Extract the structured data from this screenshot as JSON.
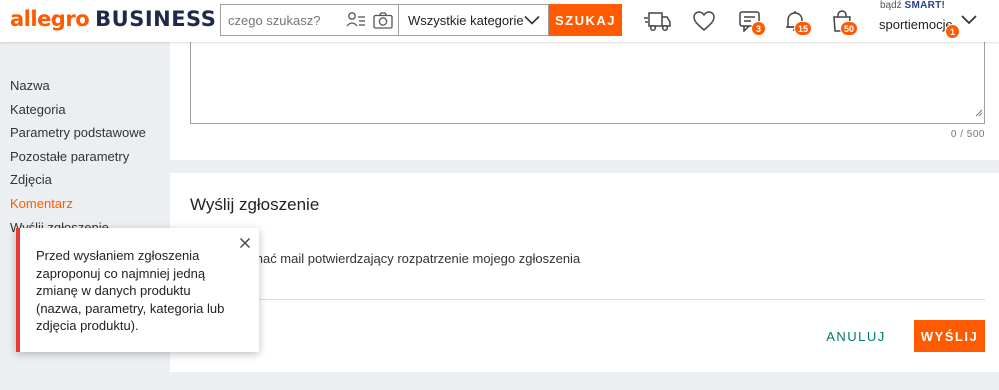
{
  "header": {
    "logo_primary": "allegro",
    "logo_secondary": "BUSINESS",
    "search": {
      "placeholder": "czego szukasz?",
      "category": "Wszystkie kategorie",
      "button_label": "SZUKAJ"
    },
    "icons": [
      {
        "name": "delivery-truck-icon"
      },
      {
        "name": "heart-icon"
      },
      {
        "name": "messages-icon",
        "badge": "3"
      },
      {
        "name": "bell-icon",
        "badge": "15"
      },
      {
        "name": "shopping-bag-icon",
        "badge": "50"
      }
    ],
    "smart_prefix": "bądź",
    "smart_label": "SMART!",
    "user_name": "sportiemocje",
    "user_badge": "1"
  },
  "sidebar": {
    "items": [
      {
        "label": "Nazwa"
      },
      {
        "label": "Kategoria"
      },
      {
        "label": "Parametry podstawowe"
      },
      {
        "label": "Pozostałe parametry"
      },
      {
        "label": "Zdjęcia"
      },
      {
        "label": "Komentarz"
      },
      {
        "label": "Wyślij zgłoszenie"
      }
    ]
  },
  "comment_card": {
    "counter": "0 / 500"
  },
  "submit_card": {
    "title": "Wyślij zgłoszenie",
    "checkbox_label": "Chcę otrzymać mail potwierdzający rozpatrzenie mojego zgłoszenia",
    "cancel_label": "ANULUJ",
    "submit_label": "WYŚLIJ"
  },
  "toast": {
    "message": "Przed wysłaniem zgłoszenia zaproponuj co najmniej jedną zmianę w danych produktu (nazwa, parametry, kategoria lub zdjęcia produktu)."
  },
  "colors": {
    "accent": "#ff5a00",
    "brand_dark": "#202a48",
    "cancel_text": "#00796b",
    "error_border": "#e53935"
  }
}
